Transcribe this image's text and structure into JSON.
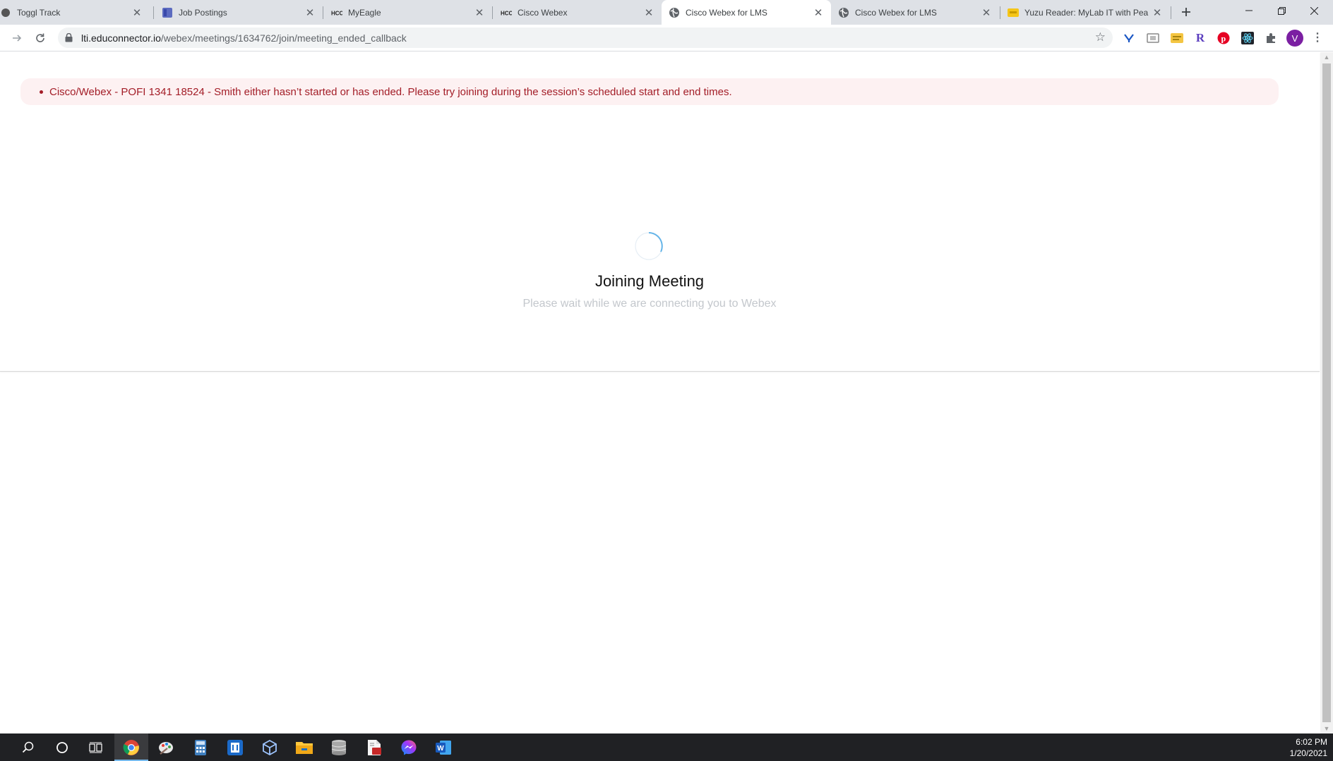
{
  "browser": {
    "tabs": [
      {
        "title": "Toggl Track",
        "icon": "toggl-icon"
      },
      {
        "title": "Job Postings",
        "icon": "job-postings-icon"
      },
      {
        "title": "MyEagle",
        "icon": "hcc-icon"
      },
      {
        "title": "Cisco Webex",
        "icon": "hcc-icon"
      },
      {
        "title": "Cisco Webex for LMS",
        "icon": "globe-icon",
        "active": true
      },
      {
        "title": "Cisco Webex for LMS",
        "icon": "globe-icon"
      },
      {
        "title": "Yuzu Reader: MyLab IT with Pea",
        "icon": "yuzu-icon"
      }
    ],
    "url_host": "lti.educonnector.io",
    "url_path": "/webex/meetings/1634762/join/meeting_ended_callback",
    "profile_initial": "V",
    "extensions": [
      "yoroi-icon",
      "cast-icon",
      "notes-icon",
      "r-icon",
      "pinterest-icon",
      "react-icon",
      "puzzle-icon"
    ]
  },
  "page": {
    "alert_text": "Cisco/Webex - POFI 1341 18524 - Smith either hasn’t started or has ended. Please try joining during the session’s scheduled start and end times.",
    "title": "Joining Meeting",
    "subtitle": "Please wait while we are connecting you to Webex"
  },
  "taskbar": {
    "time": "6:02 PM",
    "date": "1/20/2021",
    "apps": [
      "search-icon",
      "cortana-icon",
      "task-view-icon",
      "chrome-icon",
      "paint-icon",
      "calculator-icon",
      "notepad-icon",
      "virtualbox-icon",
      "file-explorer-icon",
      "database-icon",
      "document-icon",
      "messenger-icon",
      "word-icon"
    ]
  },
  "colors": {
    "alert_text": "#a31d27",
    "alert_bg": "#fdf1f2",
    "spinner": "#64b4e8"
  }
}
